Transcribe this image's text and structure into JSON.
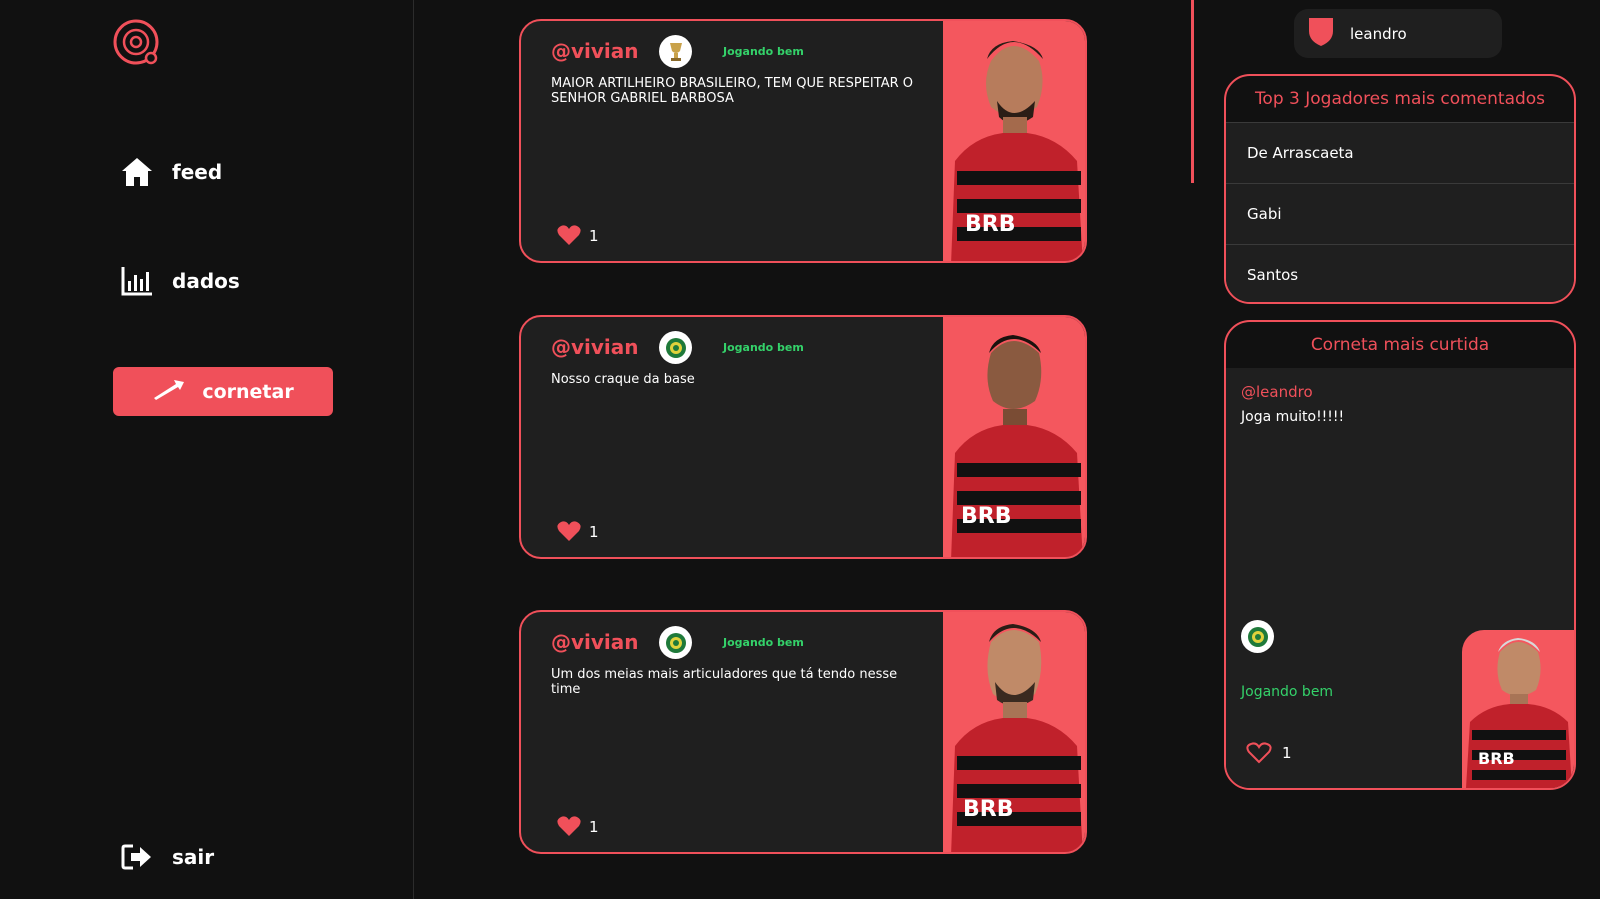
{
  "nav": {
    "feed_label": "feed",
    "dados_label": "dados",
    "cornetar_label": "cornetar",
    "sair_label": "sair"
  },
  "posts": [
    {
      "author": "@vivian",
      "badge_icon": "libertadores-trophy-icon",
      "status": "Jogando bem",
      "text": "MAIOR ARTILHEIRO BRASILEIRO, TEM QUE RESPEITAR O SENHOR GABRIEL BARBOSA",
      "likes": "1"
    },
    {
      "author": "@vivian",
      "badge_icon": "brasileirao-icon",
      "status": "Jogando bem",
      "text": "Nosso craque da base",
      "likes": "1"
    },
    {
      "author": "@vivian",
      "badge_icon": "brasileirao-icon",
      "status": "Jogando bem",
      "text": "Um dos meias mais articuladores que tá tendo nesse time",
      "likes": "1"
    }
  ],
  "user": {
    "name": "leandro"
  },
  "top3": {
    "title": "Top 3 Jogadores mais comentados",
    "players": [
      "De Arrascaeta",
      "Gabi",
      "Santos"
    ]
  },
  "most_liked": {
    "title": "Corneta mais curtida",
    "author": "@leandro",
    "text": "Joga muito!!!!!",
    "status": "Jogando bem",
    "likes": "1"
  },
  "colors": {
    "accent": "#f0505a",
    "status_green": "#34d26a",
    "card_bg": "#1f1f1f",
    "page_bg": "#111111"
  }
}
